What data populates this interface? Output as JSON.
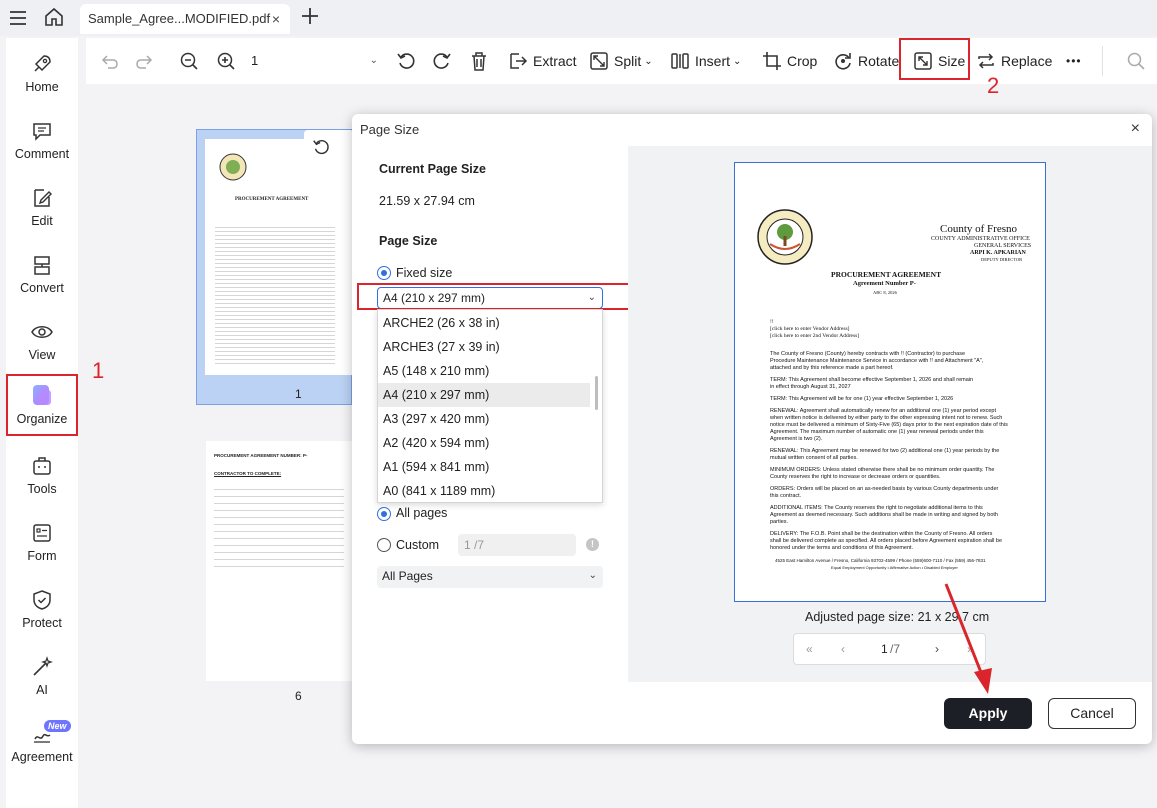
{
  "tab": {
    "title": "Sample_Agree...MODIFIED.pdf",
    "close": "×"
  },
  "nav": {
    "items": [
      {
        "label": "Home"
      },
      {
        "label": "Comment"
      },
      {
        "label": "Edit"
      },
      {
        "label": "Convert"
      },
      {
        "label": "View"
      },
      {
        "label": "Organize"
      },
      {
        "label": "Tools"
      },
      {
        "label": "Form"
      },
      {
        "label": "Protect"
      },
      {
        "label": "AI"
      },
      {
        "label": "Agreement"
      }
    ],
    "new_badge": "New"
  },
  "toolbar": {
    "page_value": "1",
    "extract": "Extract",
    "split": "Split",
    "insert": "Insert",
    "crop": "Crop",
    "rotate": "Rotate",
    "size": "Size",
    "replace": "Replace",
    "more": "•••"
  },
  "annotations": {
    "step1": "1",
    "step2": "2"
  },
  "thumbnails": {
    "page1_num": "1",
    "page6_num": "6"
  },
  "dialog": {
    "title": "Page Size",
    "close": "×",
    "current_label": "Current Page Size",
    "current_value": "21.59 x 27.94 cm",
    "page_size_label": "Page Size",
    "fixed_size": "Fixed size",
    "selected_size": "A4 (210 x 297 mm)",
    "options": [
      "ARCHE2 (26 x 38 in)",
      "ARCHE3 (27 x 39 in)",
      "A5 (148 x 210 mm)",
      "A4 (210 x 297 mm)",
      "A3 (297 x 420 mm)",
      "A2 (420 x 594 mm)",
      "A1 (594 x 841 mm)",
      "A0 (841 x 1189 mm)"
    ],
    "all_pages": "All pages",
    "custom": "Custom",
    "custom_placeholder": "1 /7",
    "info": "!",
    "pages_select": "All Pages",
    "adjusted": "Adjusted page size: 21 x 29.7 cm",
    "pager": {
      "first": "«",
      "prev": "‹",
      "page": "1",
      "total": "/7",
      "next": "›",
      "last": "»"
    },
    "apply": "Apply",
    "cancel": "Cancel"
  },
  "preview": {
    "seal_text": "THE COUNTY OF FRESNO",
    "county": "County of Fresno",
    "office": "COUNTY ADMINISTRATIVE OFFICE",
    "services": "GENERAL SERVICES",
    "name": "ARPI K. APKARIAN",
    "role": "DEPUTY DIRECTOR",
    "heading": "PROCUREMENT AGREEMENT",
    "subheading": "Agreement Number P-",
    "date": "ABC 8, 2026",
    "l1": "!!",
    "l2": "[click here to enter Vendor Address]",
    "l3": "[click here to enter 2nd Vendor Address]",
    "p1": "The County of Fresno (County) hereby contracts with !! (Contractor) to purchase",
    "p1b": "Procedure Maintenance       Maintenance Service in accordance with !! and Attachment \"A\",",
    "p1c": "attached and by this reference made a part hereof.",
    "term1": "TERM:  This Agreement shall become effective September 1, 2026             and shall remain",
    "term1b": "in effect through August 31, 2027",
    "term2": "TERM:  This Agreement will be for one (1) year effective September 1, 2026",
    "renewal1": "RENEWAL:  Agreement shall automatically renew for an additional one (1) year period except",
    "renewal1b": "when written notice is delivered by either party to the other expressing intent not to renew. Such",
    "renewal1c": "notice must be delivered a minimum of Sixty-Five (65) days   prior to the next expiration date of this",
    "renewal1d": "Agreement.  The maximum number of automatic one (1) year renewal periods under this",
    "renewal1e": "Agreement is two (2).",
    "renewal2": "RENEWAL:  This Agreement may be renewed for two (2) additional one (1) year periods by the",
    "renewal2b": "mutual written consent of all parties.",
    "minorders": "MINIMUM ORDERS:  Unless stated otherwise there shall be no minimum order quantity.  The",
    "minordersb": "County reserves the right to increase or decrease orders or quantities.",
    "orders": "ORDERS:  Orders will be placed on an as-needed basis by various County departments under",
    "ordersb": "this contract.",
    "additems": "ADDITIONAL ITEMS:  The County reserves the right to negotiate additional items to this",
    "additemsb": "Agreement as deemed necessary. Such additions shall be made in writing and signed by both",
    "additemsc": "parties.",
    "delivery": "DELIVERY:  The F.O.B. Point shall be the destination within the County of Fresno.  All orders",
    "deliveryb": "shall be delivered complete as specified. All orders placed before Agreement expiration shall be",
    "deliveryc": "honored under the terms and conditions of this Agreement.",
    "footer": "4525 East Hamilton Avenue / Fresno, California 93702-4599 / Phone (559)600-7110 / Fax (559) 456-7831",
    "footer2": "Equal Employment Opportunity • Affirmative Action • Disabled Employer"
  },
  "thumb6": {
    "heading": "PROCUREMENT AGREEMENT NUMBER: P-",
    "sub": "CONTRACTOR TO COMPLETE:"
  },
  "colors": {
    "accent": "#2f6fe6",
    "annotation": "#d9252b",
    "apply_bg": "#1c1f26"
  }
}
